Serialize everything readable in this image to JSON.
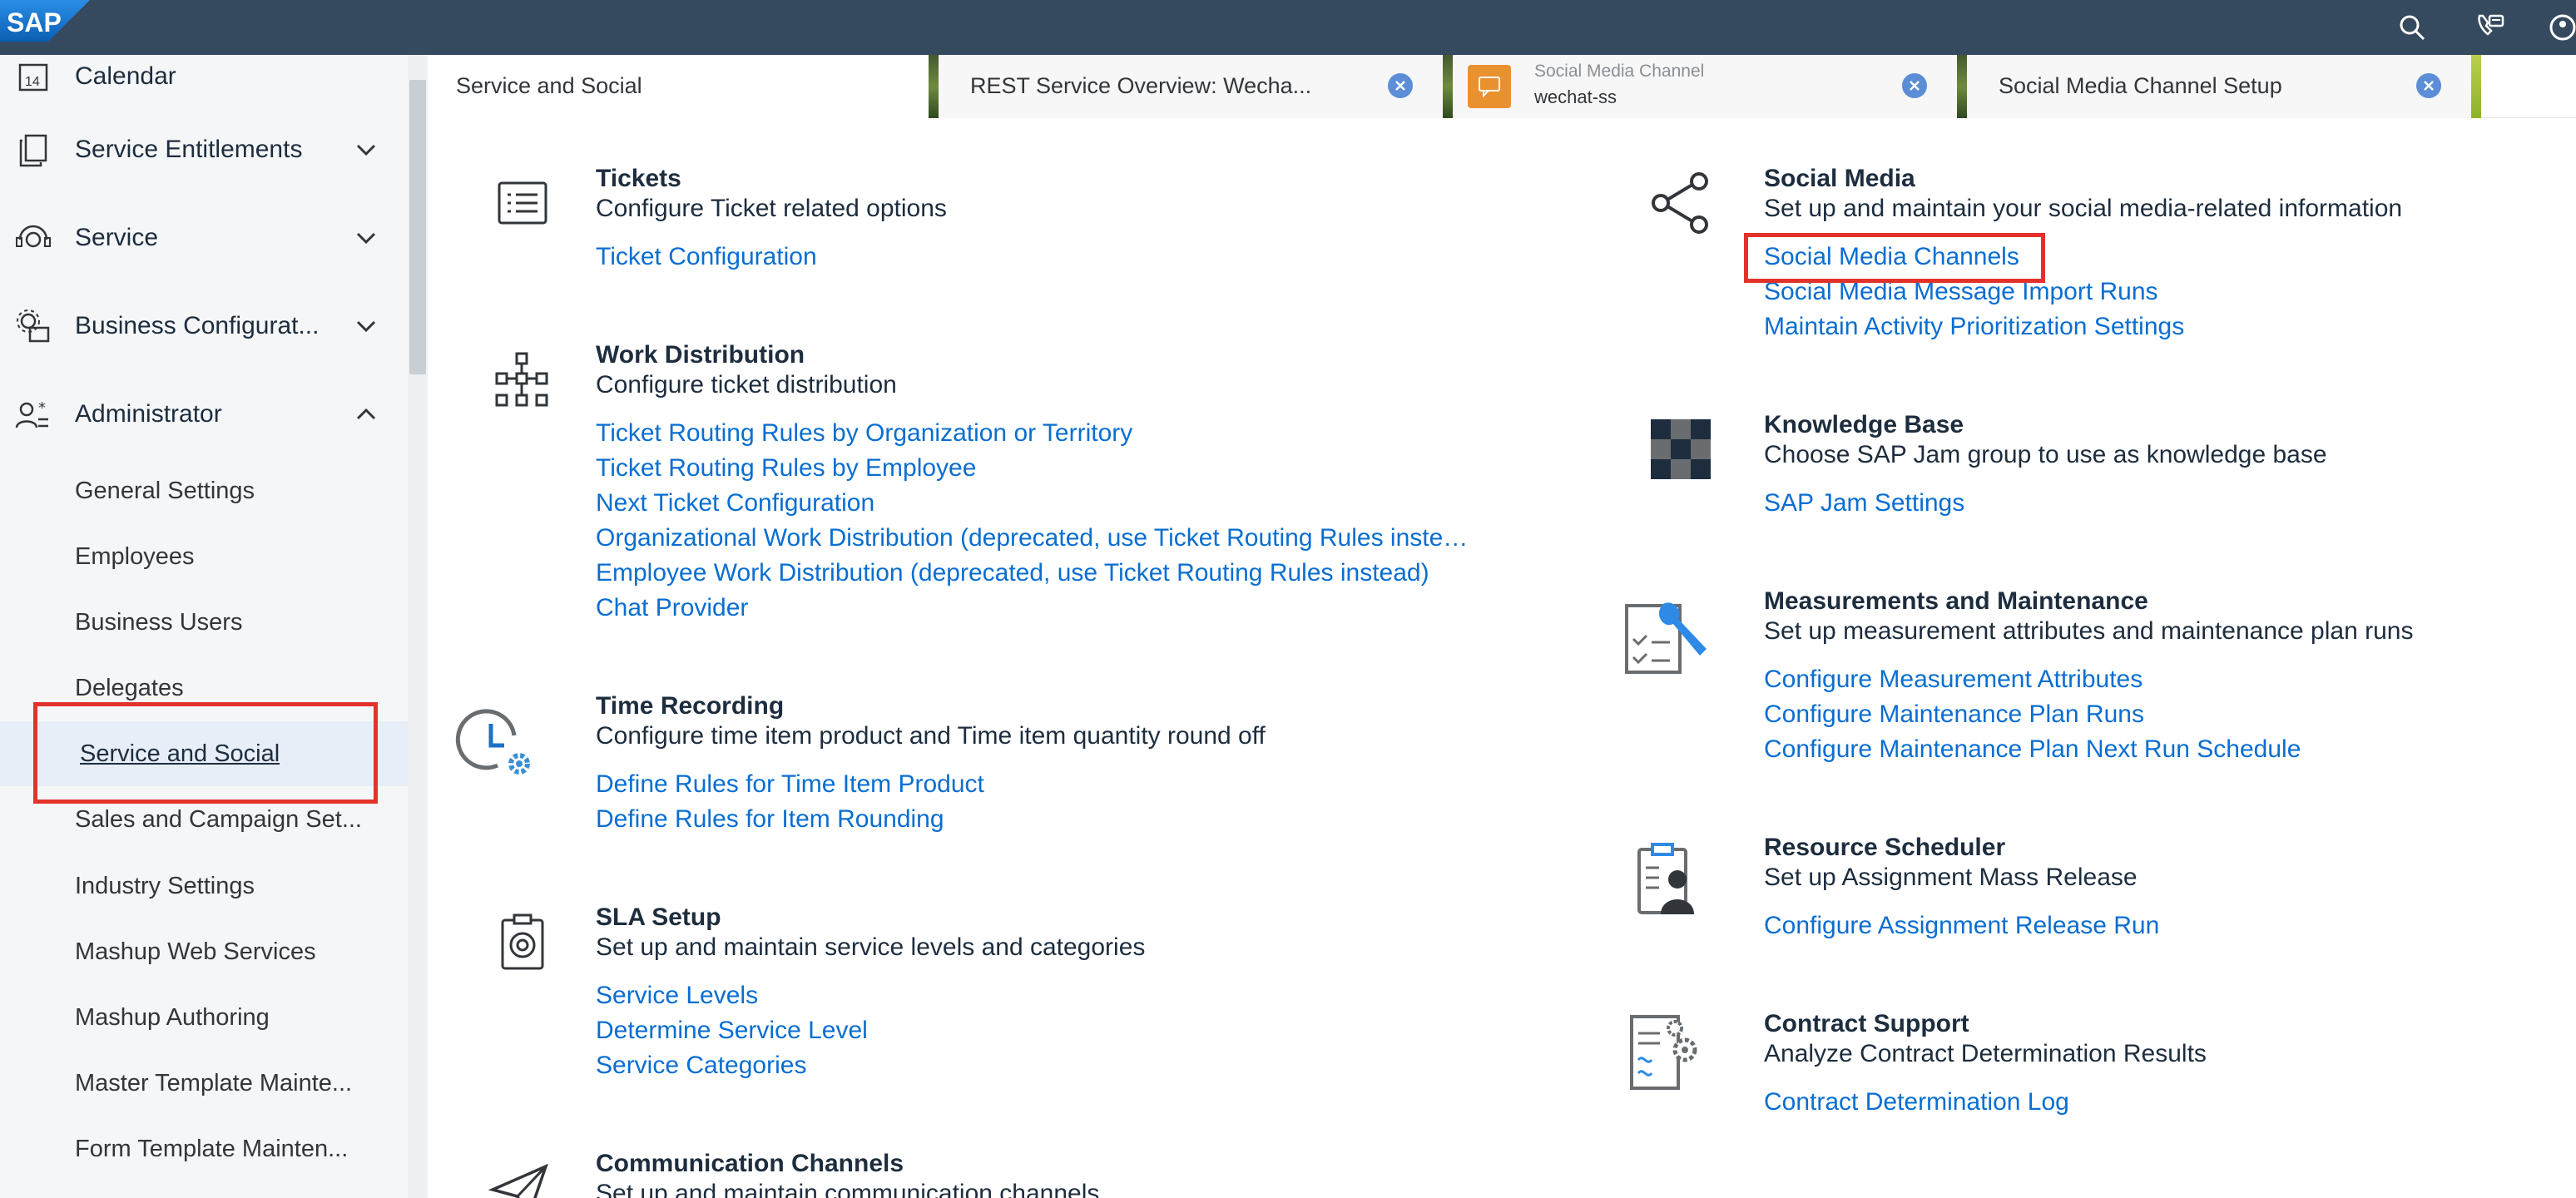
{
  "shell": {
    "logo_text": "SAP",
    "icons": [
      "search-icon",
      "phone-chat-icon",
      "user-icon"
    ]
  },
  "sidebar": {
    "calendar_label": "Calendar",
    "calendar_day": "14",
    "items": [
      {
        "label": "Service Entitlements",
        "icon": "copy-icon",
        "expanded": false
      },
      {
        "label": "Service",
        "icon": "headset-icon",
        "expanded": false
      },
      {
        "label": "Business Configurat...",
        "icon": "gear-building-icon",
        "expanded": false
      },
      {
        "label": "Administrator",
        "icon": "user-admin-icon",
        "expanded": true
      }
    ],
    "sub_items": [
      {
        "label": "General Settings"
      },
      {
        "label": "Employees"
      },
      {
        "label": "Business Users"
      },
      {
        "label": "Delegates"
      },
      {
        "label": "Service and Social",
        "selected": true
      },
      {
        "label": "Sales and Campaign Set..."
      },
      {
        "label": "Industry Settings"
      },
      {
        "label": "Mashup Web Services"
      },
      {
        "label": "Mashup Authoring"
      },
      {
        "label": "Master Template Mainte..."
      },
      {
        "label": "Form Template Mainten..."
      }
    ]
  },
  "tabs": [
    {
      "label": "Service and Social",
      "active": true
    },
    {
      "label": "REST Service Overview: Wecha..."
    },
    {
      "title": "Social Media Channel",
      "value": "wechat-ss"
    },
    {
      "label": "Social Media Channel Setup"
    }
  ],
  "left_sections": [
    {
      "title": "Tickets",
      "desc": "Configure Ticket related options",
      "icon": "list-icon",
      "links": [
        "Ticket Configuration"
      ]
    },
    {
      "title": "Work Distribution",
      "desc": "Configure ticket distribution",
      "icon": "org-chart-icon",
      "links": [
        "Ticket Routing Rules by Organization or Territory",
        "Ticket Routing Rules by Employee",
        "Next Ticket Configuration",
        "Organizational Work Distribution (deprecated, use Ticket Routing Rules inste…",
        "Employee Work Distribution (deprecated, use Ticket Routing Rules instead)",
        "Chat Provider"
      ]
    },
    {
      "title": "Time Recording",
      "desc": "Configure time item product and Time item quantity round off",
      "icon": "clock-settings-icon",
      "links": [
        "Define Rules for Time Item Product",
        "Define Rules for Item Rounding"
      ]
    },
    {
      "title": "SLA Setup",
      "desc": "Set up and maintain service levels and categories",
      "icon": "clipboard-target-icon",
      "links": [
        "Service Levels",
        "Determine Service Level",
        "Service Categories"
      ]
    },
    {
      "title": "Communication Channels",
      "desc": "Set up and maintain communication channels",
      "icon": "paper-plane-icon",
      "links": []
    }
  ],
  "right_sections": [
    {
      "title": "Social Media",
      "desc": "Set up and maintain your social media-related information",
      "icon": "share-icon",
      "links": [
        "Social Media Channels",
        "Social Media Message Import Runs",
        "Maintain Activity Prioritization Settings"
      ]
    },
    {
      "title": "Knowledge Base",
      "desc": "Choose SAP Jam group to use as knowledge base",
      "icon": "jam-icon",
      "links": [
        "SAP Jam Settings"
      ]
    },
    {
      "title": "Measurements and Maintenance",
      "desc": "Set up measurement attributes and maintenance plan runs",
      "icon": "wrench-checklist-icon",
      "links": [
        "Configure Measurement Attributes",
        "Configure Maintenance Plan Runs",
        "Configure Maintenance Plan Next Run Schedule"
      ]
    },
    {
      "title": "Resource Scheduler",
      "desc": "Set up Assignment Mass Release",
      "icon": "resource-person-icon",
      "links": [
        "Configure Assignment Release Run"
      ]
    },
    {
      "title": "Contract Support",
      "desc": "Analyze Contract Determination Results",
      "icon": "contract-gear-icon",
      "links": [
        "Contract Determination Log"
      ]
    }
  ],
  "colors": {
    "shell": "#354a5f",
    "link": "#0a6ed1",
    "highlight": "#e2332b"
  }
}
